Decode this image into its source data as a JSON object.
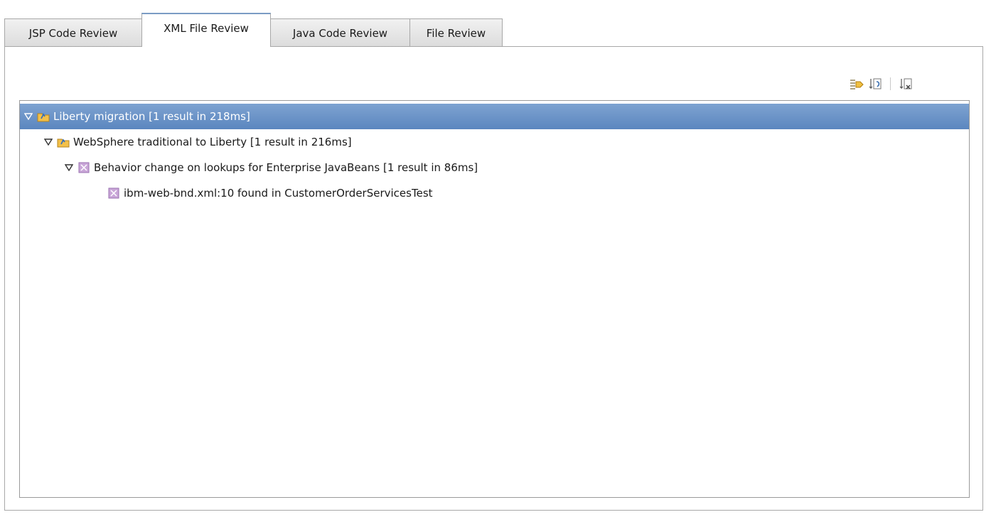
{
  "tabs": [
    {
      "label": "JSP Code Review",
      "active": false
    },
    {
      "label": "XML File Review",
      "active": true
    },
    {
      "label": "Java Code Review",
      "active": false
    },
    {
      "label": "File Review",
      "active": false
    }
  ],
  "toolbar": {
    "buttons": [
      {
        "icon": "expand-all-icon"
      },
      {
        "icon": "export-icon"
      },
      {
        "icon": "clear-results-icon"
      }
    ]
  },
  "tree": {
    "rows": [
      {
        "label": "Liberty migration [1 result in 218ms]",
        "icon": "folder-rules-icon",
        "expanded": true,
        "selected": true
      },
      {
        "label": "WebSphere traditional to Liberty [1 result in 216ms]",
        "icon": "folder-rules-icon",
        "expanded": true,
        "selected": false
      },
      {
        "label": "Behavior change on lookups for Enterprise JavaBeans [1 result in 86ms]",
        "icon": "rule-icon",
        "expanded": true,
        "selected": false
      },
      {
        "label": "ibm-web-bnd.xml:10 found in CustomerOrderServicesTest",
        "icon": "result-icon",
        "expanded": false,
        "selected": false
      }
    ]
  },
  "colors": {
    "selection": "#5b86bf",
    "rule_icon": "#c9a6d8"
  }
}
